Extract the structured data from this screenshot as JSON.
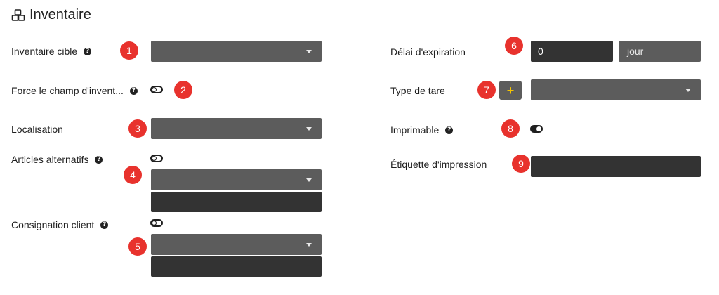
{
  "section": {
    "title": "Inventaire",
    "icon": "cubes-icon"
  },
  "left": {
    "target_inventory": {
      "label": "Inventaire cible",
      "badge": "1"
    },
    "force_field": {
      "label": "Force le champ d'invent...",
      "badge": "2",
      "toggle_on": false
    },
    "location": {
      "label": "Localisation",
      "badge": "3"
    },
    "alt_articles": {
      "label": "Articles alternatifs",
      "badge": "4",
      "toggle_on": false
    },
    "client_consignment": {
      "label": "Consignation client",
      "badge": "5",
      "toggle_on": false
    }
  },
  "right": {
    "expiration": {
      "label": "Délai d'expiration",
      "badge": "6",
      "value": "0",
      "unit": "jour"
    },
    "tare_type": {
      "label": "Type de tare",
      "badge": "7",
      "add_label": "+"
    },
    "printable": {
      "label": "Imprimable",
      "badge": "8",
      "toggle_on": true
    },
    "print_label": {
      "label": "Étiquette d'impression",
      "badge": "9",
      "value": ""
    }
  },
  "colors": {
    "badge": "#e8322d",
    "select": "#5c5c5c",
    "input": "#333333",
    "plus": "#f5c400"
  }
}
